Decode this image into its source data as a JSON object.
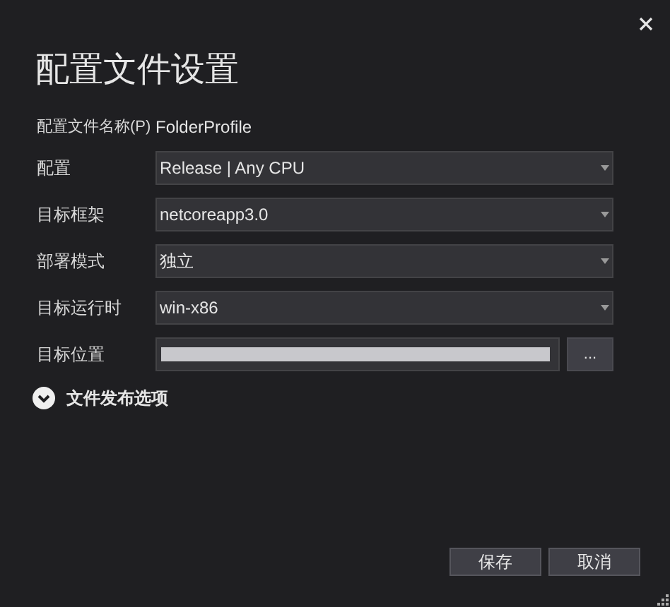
{
  "dialog": {
    "title": "配置文件设置"
  },
  "profile_name": {
    "label": "配置文件名称(P)",
    "value": "FolderProfile"
  },
  "fields": [
    {
      "kind": "dropdown",
      "label": "配置",
      "value": "Release | Any CPU"
    },
    {
      "kind": "dropdown",
      "label": "目标框架",
      "value": "netcoreapp3.0"
    },
    {
      "kind": "dropdown",
      "label": "部署模式",
      "value": "独立"
    },
    {
      "kind": "dropdown",
      "label": "目标运行时",
      "value": "win-x86"
    },
    {
      "kind": "path",
      "label": "目标位置",
      "redacted": true,
      "browse": "..."
    }
  ],
  "expander": {
    "label": "文件发布选项",
    "expanded": false
  },
  "buttons": [
    "保存",
    "取消"
  ]
}
